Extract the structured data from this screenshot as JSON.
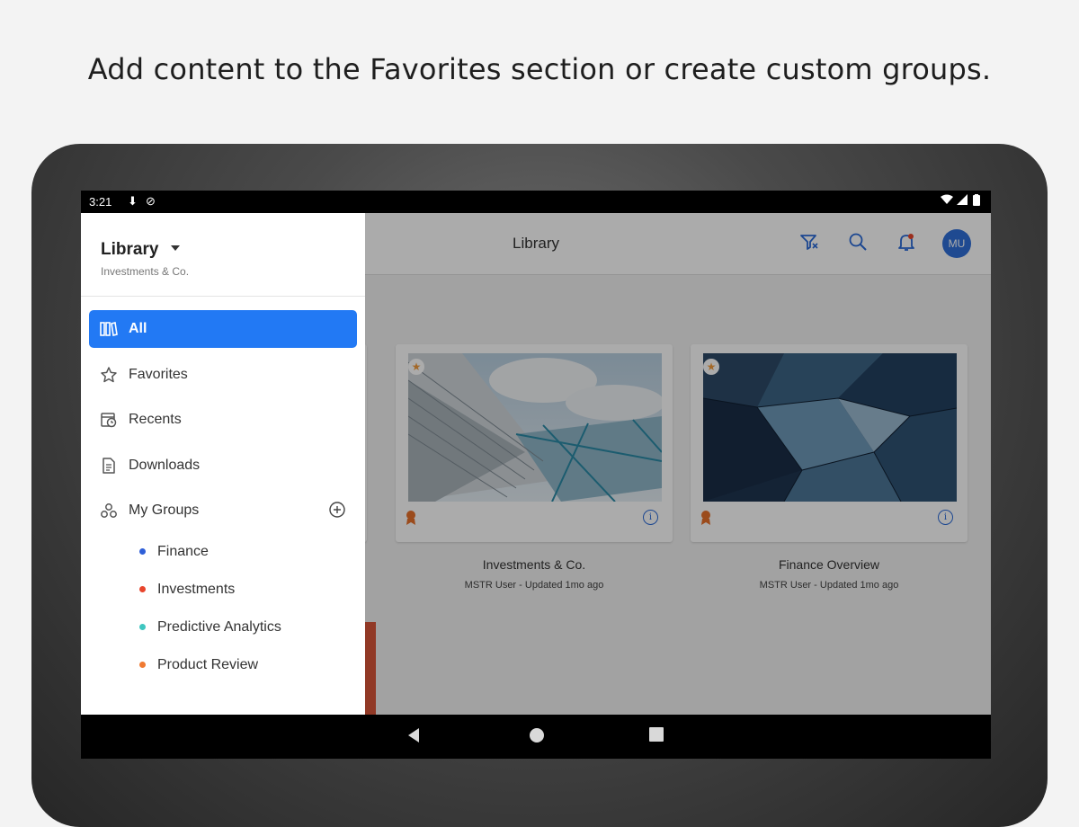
{
  "caption": "Add content to the Favorites section or create custom groups.",
  "status_bar": {
    "time": "3:21"
  },
  "header": {
    "title": "Library",
    "avatar_initials": "MU"
  },
  "drawer": {
    "title": "Library",
    "subtitle": "Investments & Co.",
    "nav": [
      {
        "label": "All",
        "icon": "library-grid-icon",
        "active": true
      },
      {
        "label": "Favorites",
        "icon": "star-outline-icon"
      },
      {
        "label": "Recents",
        "icon": "recents-clock-icon"
      },
      {
        "label": "Downloads",
        "icon": "document-icon"
      },
      {
        "label": "My Groups",
        "icon": "groups-icon"
      }
    ],
    "groups": [
      {
        "label": "Finance",
        "color": "#2f5fd8"
      },
      {
        "label": "Investments",
        "color": "#e8452c"
      },
      {
        "label": "Predictive Analytics",
        "color": "#3fc6c0"
      },
      {
        "label": "Product Review",
        "color": "#f07a32"
      }
    ]
  },
  "cards": [
    {
      "title": "Investments & Co.",
      "owner": "MSTR User",
      "updated": " - Updated 1mo ago",
      "favorite": true
    },
    {
      "title": "Finance Overview",
      "owner": "MSTR User",
      "updated": " - Updated 1mo ago",
      "favorite": true
    }
  ],
  "colors": {
    "accent": "#2279f4",
    "star": "#f39c3c",
    "badge": "#e8702a"
  }
}
